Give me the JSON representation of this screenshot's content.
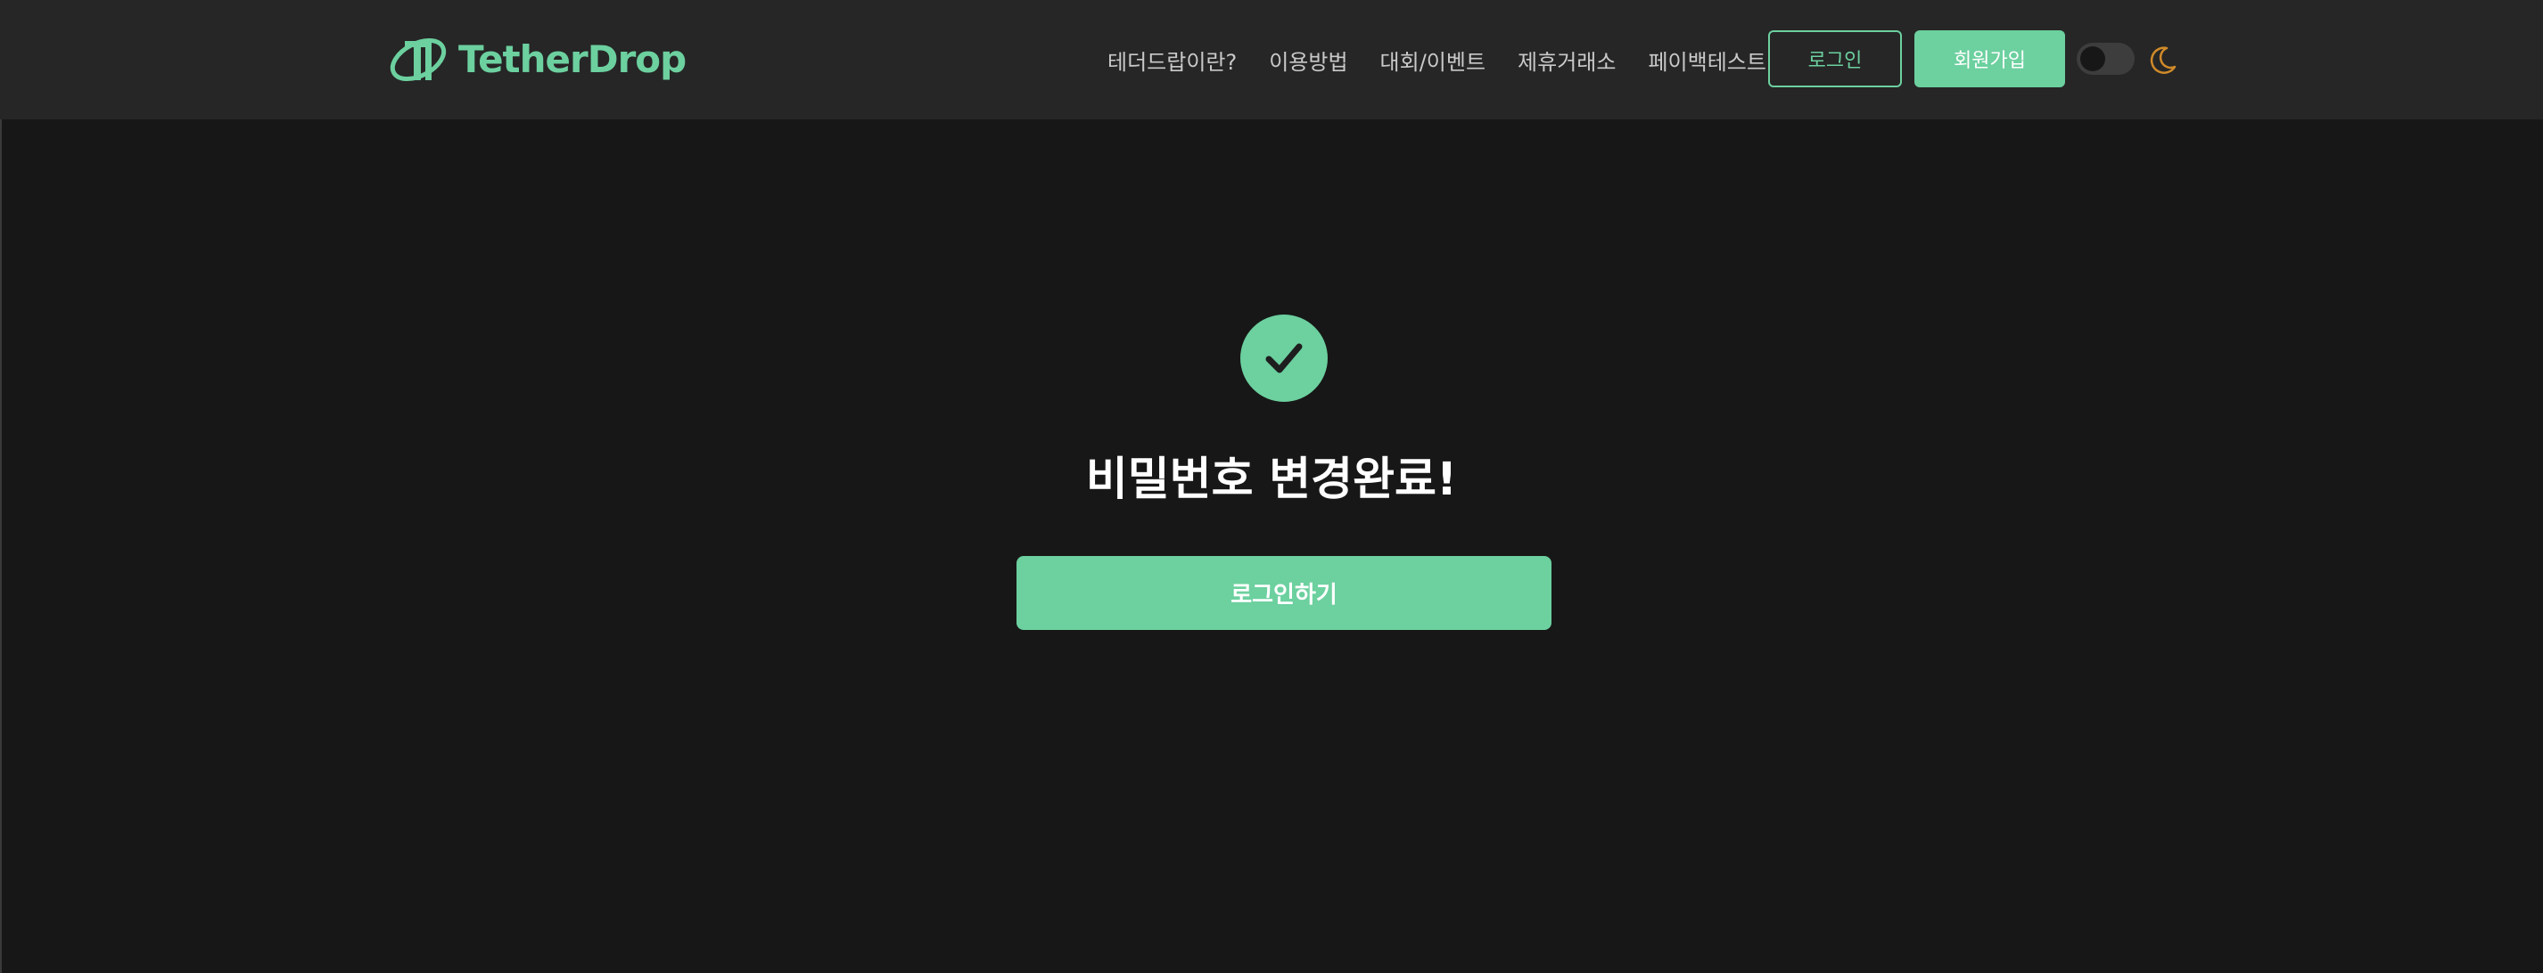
{
  "header": {
    "logo_text": "TetherDrop",
    "nav": [
      {
        "label": "테더드랍이란?"
      },
      {
        "label": "이용방법"
      },
      {
        "label": "대회/이벤트"
      },
      {
        "label": "제휴거래소"
      },
      {
        "label": "페이백테스트"
      }
    ],
    "login_label": "로그인",
    "signup_label": "회원가입",
    "theme_toggle_icon": "moon-icon"
  },
  "main": {
    "status_icon": "check-icon",
    "title": "비밀번호 변경완료!",
    "button_label": "로그인하기"
  },
  "colors": {
    "accent": "#6cd09f",
    "background": "#171717",
    "header_bg": "#262626",
    "moon": "#d08a2a"
  }
}
